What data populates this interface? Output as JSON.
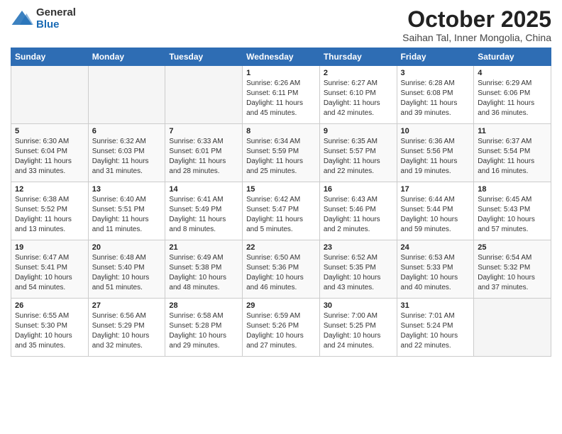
{
  "header": {
    "logo_general": "General",
    "logo_blue": "Blue",
    "main_title": "October 2025",
    "subtitle": "Saihan Tal, Inner Mongolia, China"
  },
  "columns": [
    "Sunday",
    "Monday",
    "Tuesday",
    "Wednesday",
    "Thursday",
    "Friday",
    "Saturday"
  ],
  "weeks": [
    [
      {
        "day": "",
        "info": ""
      },
      {
        "day": "",
        "info": ""
      },
      {
        "day": "",
        "info": ""
      },
      {
        "day": "1",
        "info": "Sunrise: 6:26 AM\nSunset: 6:11 PM\nDaylight: 11 hours\nand 45 minutes."
      },
      {
        "day": "2",
        "info": "Sunrise: 6:27 AM\nSunset: 6:10 PM\nDaylight: 11 hours\nand 42 minutes."
      },
      {
        "day": "3",
        "info": "Sunrise: 6:28 AM\nSunset: 6:08 PM\nDaylight: 11 hours\nand 39 minutes."
      },
      {
        "day": "4",
        "info": "Sunrise: 6:29 AM\nSunset: 6:06 PM\nDaylight: 11 hours\nand 36 minutes."
      }
    ],
    [
      {
        "day": "5",
        "info": "Sunrise: 6:30 AM\nSunset: 6:04 PM\nDaylight: 11 hours\nand 33 minutes."
      },
      {
        "day": "6",
        "info": "Sunrise: 6:32 AM\nSunset: 6:03 PM\nDaylight: 11 hours\nand 31 minutes."
      },
      {
        "day": "7",
        "info": "Sunrise: 6:33 AM\nSunset: 6:01 PM\nDaylight: 11 hours\nand 28 minutes."
      },
      {
        "day": "8",
        "info": "Sunrise: 6:34 AM\nSunset: 5:59 PM\nDaylight: 11 hours\nand 25 minutes."
      },
      {
        "day": "9",
        "info": "Sunrise: 6:35 AM\nSunset: 5:57 PM\nDaylight: 11 hours\nand 22 minutes."
      },
      {
        "day": "10",
        "info": "Sunrise: 6:36 AM\nSunset: 5:56 PM\nDaylight: 11 hours\nand 19 minutes."
      },
      {
        "day": "11",
        "info": "Sunrise: 6:37 AM\nSunset: 5:54 PM\nDaylight: 11 hours\nand 16 minutes."
      }
    ],
    [
      {
        "day": "12",
        "info": "Sunrise: 6:38 AM\nSunset: 5:52 PM\nDaylight: 11 hours\nand 13 minutes."
      },
      {
        "day": "13",
        "info": "Sunrise: 6:40 AM\nSunset: 5:51 PM\nDaylight: 11 hours\nand 11 minutes."
      },
      {
        "day": "14",
        "info": "Sunrise: 6:41 AM\nSunset: 5:49 PM\nDaylight: 11 hours\nand 8 minutes."
      },
      {
        "day": "15",
        "info": "Sunrise: 6:42 AM\nSunset: 5:47 PM\nDaylight: 11 hours\nand 5 minutes."
      },
      {
        "day": "16",
        "info": "Sunrise: 6:43 AM\nSunset: 5:46 PM\nDaylight: 11 hours\nand 2 minutes."
      },
      {
        "day": "17",
        "info": "Sunrise: 6:44 AM\nSunset: 5:44 PM\nDaylight: 10 hours\nand 59 minutes."
      },
      {
        "day": "18",
        "info": "Sunrise: 6:45 AM\nSunset: 5:43 PM\nDaylight: 10 hours\nand 57 minutes."
      }
    ],
    [
      {
        "day": "19",
        "info": "Sunrise: 6:47 AM\nSunset: 5:41 PM\nDaylight: 10 hours\nand 54 minutes."
      },
      {
        "day": "20",
        "info": "Sunrise: 6:48 AM\nSunset: 5:40 PM\nDaylight: 10 hours\nand 51 minutes."
      },
      {
        "day": "21",
        "info": "Sunrise: 6:49 AM\nSunset: 5:38 PM\nDaylight: 10 hours\nand 48 minutes."
      },
      {
        "day": "22",
        "info": "Sunrise: 6:50 AM\nSunset: 5:36 PM\nDaylight: 10 hours\nand 46 minutes."
      },
      {
        "day": "23",
        "info": "Sunrise: 6:52 AM\nSunset: 5:35 PM\nDaylight: 10 hours\nand 43 minutes."
      },
      {
        "day": "24",
        "info": "Sunrise: 6:53 AM\nSunset: 5:33 PM\nDaylight: 10 hours\nand 40 minutes."
      },
      {
        "day": "25",
        "info": "Sunrise: 6:54 AM\nSunset: 5:32 PM\nDaylight: 10 hours\nand 37 minutes."
      }
    ],
    [
      {
        "day": "26",
        "info": "Sunrise: 6:55 AM\nSunset: 5:30 PM\nDaylight: 10 hours\nand 35 minutes."
      },
      {
        "day": "27",
        "info": "Sunrise: 6:56 AM\nSunset: 5:29 PM\nDaylight: 10 hours\nand 32 minutes."
      },
      {
        "day": "28",
        "info": "Sunrise: 6:58 AM\nSunset: 5:28 PM\nDaylight: 10 hours\nand 29 minutes."
      },
      {
        "day": "29",
        "info": "Sunrise: 6:59 AM\nSunset: 5:26 PM\nDaylight: 10 hours\nand 27 minutes."
      },
      {
        "day": "30",
        "info": "Sunrise: 7:00 AM\nSunset: 5:25 PM\nDaylight: 10 hours\nand 24 minutes."
      },
      {
        "day": "31",
        "info": "Sunrise: 7:01 AM\nSunset: 5:24 PM\nDaylight: 10 hours\nand 22 minutes."
      },
      {
        "day": "",
        "info": ""
      }
    ]
  ]
}
